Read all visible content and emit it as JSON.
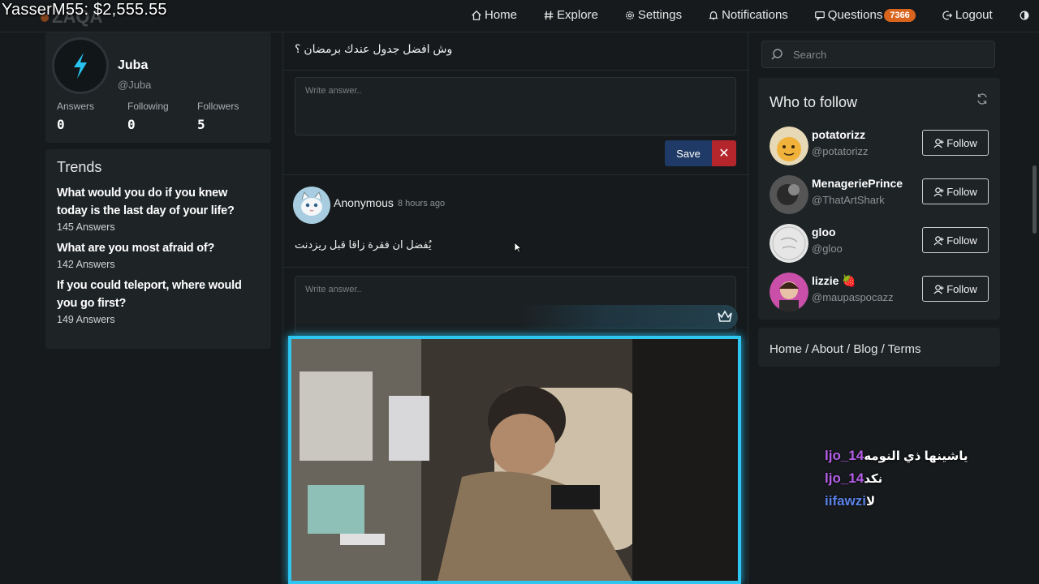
{
  "overlay": {
    "money": "YasserM55: $2,555.55"
  },
  "navbar": {
    "items": [
      {
        "label": "Home",
        "icon": "home-icon"
      },
      {
        "label": "Explore",
        "icon": "hash-icon"
      },
      {
        "label": "Settings",
        "icon": "gear-icon"
      },
      {
        "label": "Notifications",
        "icon": "bell-icon"
      },
      {
        "label": "Questions",
        "icon": "chat-icon",
        "badge": "7366"
      },
      {
        "label": "Logout",
        "icon": "logout-icon"
      }
    ],
    "theme_toggle": "contrast-icon"
  },
  "profile": {
    "name": "Juba",
    "handle": "@Juba",
    "stats": [
      {
        "label": "Answers",
        "value": "0"
      },
      {
        "label": "Following",
        "value": "0"
      },
      {
        "label": "Followers",
        "value": "5"
      }
    ]
  },
  "trends": {
    "title": "Trends",
    "items": [
      {
        "question": "What would you do if you knew today is the last day of your life?",
        "answers": "145 Answers"
      },
      {
        "question": "What are you most afraid of?",
        "answers": "142 Answers"
      },
      {
        "question": "If you could teleport, where would you go first?",
        "answers": "149 Answers"
      }
    ]
  },
  "feed": {
    "question1": "وش افضل جدول عندك برمضان ؟",
    "answer_placeholder": "Write answer..",
    "save_label": "Save",
    "cancel_label": "✕",
    "post": {
      "author": "Anonymous",
      "time": "8 hours ago",
      "text": "يُفضل ان فقرة زاقا قبل ريزدنت"
    }
  },
  "sidebar": {
    "search_placeholder": "Search",
    "who_to_follow": "Who to follow",
    "follow_label": "Follow",
    "users": [
      {
        "name": "potatorizz",
        "handle": "@potatorizz"
      },
      {
        "name": "MenageriePrince",
        "handle": "@ThatArtShark"
      },
      {
        "name": "gloo",
        "handle": "@gloo"
      },
      {
        "name": "lizzie 🍓",
        "handle": "@maupaspocazz"
      }
    ],
    "footer": "Home / About / Blog / Terms"
  },
  "chat": [
    {
      "name": "ljo_14",
      "message": "ياشينها ذي النومه"
    },
    {
      "name": "ljo_14",
      "message": "نكد"
    },
    {
      "name": "iifawzi",
      "message": "لا"
    }
  ],
  "colors": {
    "accent": "#d9641d",
    "save_button": "#1f3a66",
    "cancel_button": "#b4262c",
    "stream_border": "#2ec5f0"
  }
}
